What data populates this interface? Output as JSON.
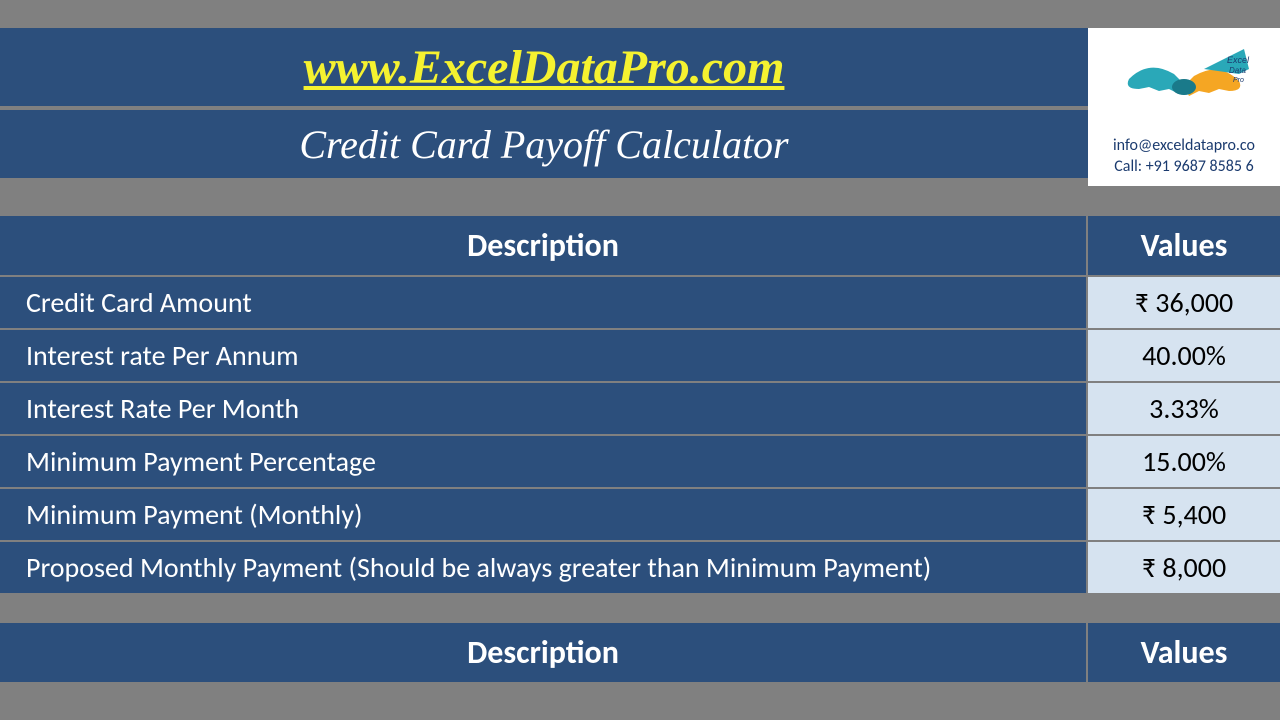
{
  "header": {
    "website": "www.ExcelDataPro.com",
    "title": "Credit Card Payoff Calculator",
    "email": "info@exceldatapro.co",
    "phone": "Call: +91 9687 8585 6"
  },
  "table1": {
    "desc_header": "Description",
    "values_header": "Values",
    "rows": [
      {
        "desc": "Credit Card Amount",
        "value": "₹ 36,000"
      },
      {
        "desc": "Interest rate Per Annum",
        "value": "40.00%"
      },
      {
        "desc": "Interest Rate Per Month",
        "value": "3.33%"
      },
      {
        "desc": "Minimum Payment Percentage",
        "value": "15.00%"
      },
      {
        "desc": "Minimum Payment (Monthly)",
        "value": "₹ 5,400"
      },
      {
        "desc": "Proposed Monthly Payment (Should be always greater than Minimum Payment)",
        "value": "₹ 8,000"
      }
    ]
  },
  "table2": {
    "desc_header": "Description",
    "values_header": "Values"
  }
}
